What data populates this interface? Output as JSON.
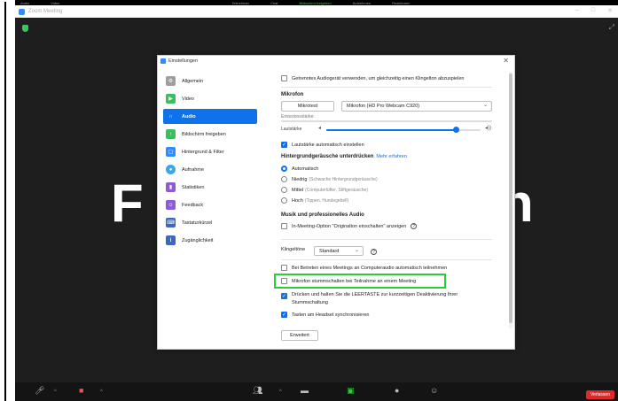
{
  "topbar": {
    "items": [
      "Audio",
      "Video",
      "Teilnehmer",
      "Chat",
      "Bildschirm freigeben",
      "Aufnehmen",
      "Reaktionen"
    ],
    "highlight_color": "#3fbf3f"
  },
  "window": {
    "title": "Zoom Meeting"
  },
  "video": {
    "left_text": "F",
    "right_text": "n"
  },
  "dialog": {
    "title": "Einstellungen",
    "sidebar": [
      {
        "label": "Allgemein",
        "icon": "gear-icon",
        "color": "#9e9e9e"
      },
      {
        "label": "Video",
        "icon": "video-icon",
        "color": "#3bbf5c"
      },
      {
        "label": "Audio",
        "icon": "headphones-icon",
        "color": "#0e72ed",
        "active": true
      },
      {
        "label": "Bildschirm freigeben",
        "icon": "share-screen-icon",
        "color": "#3bbf5c"
      },
      {
        "label": "Hintergrund & Filter",
        "icon": "background-icon",
        "color": "#2d8cff"
      },
      {
        "label": "Aufnahme",
        "icon": "record-icon",
        "color": "#3ba7e8"
      },
      {
        "label": "Statistiken",
        "icon": "statistics-icon",
        "color": "#8e5ad6"
      },
      {
        "label": "Feedback",
        "icon": "feedback-icon",
        "color": "#8e5ad6"
      },
      {
        "label": "Tastaturkürzel",
        "icon": "keyboard-icon",
        "color": "#3b66c4"
      },
      {
        "label": "Zugänglichkeit",
        "icon": "accessibility-icon",
        "color": "#3b66c4"
      }
    ],
    "audio": {
      "separate_device": "Getrenntes Audiogerät verwenden, um gleichzeitig einen Klingelton abzuspielen",
      "mic_header": "Mikrofon",
      "mic_test": "Mikrotest",
      "mic_device": "Mikrofon (HD Pro Webcam C920)",
      "emission_label": "Emissionsstärke:",
      "volume_label": "Lautstärke",
      "volume_level": 0.84,
      "auto_volume": "Lautstärke automatisch einstellen",
      "noise_header": "Hintergrundgeräusche unterdrücken",
      "learn_more": "Mehr erfahren",
      "noise_options": [
        {
          "label": "Automatisch",
          "hint": "",
          "selected": true
        },
        {
          "label": "Niedrig",
          "hint": "(Schwache Hintergrundgeräusche)",
          "selected": false
        },
        {
          "label": "Mittel",
          "hint": "(Computerlüfter, Stiftgeräusche)",
          "selected": false
        },
        {
          "label": "Hoch",
          "hint": "(Tippen, Hundegebell)",
          "selected": false
        }
      ],
      "music_header": "Musik und professionelles Audio",
      "original_sound": "In-Meeting-Option \"Originalton einschalten\" anzeigen",
      "ringtone_label": "Klingeltöne",
      "ringtone_value": "Standard",
      "auto_join_audio": "Bei Betreten eines Meetings an Computeraudio automatisch teilnehmen",
      "mute_on_join": "Mikrofon stummschalten bei Teilnahme an einem Meeting",
      "push_to_talk": "Drücken und halten Sie die LEERTASTE zur kurzzeitigen Deaktivierung Ihrer Stummschaltung",
      "sync_headset": "Tasten am Headset synchronisieren",
      "advanced": "Erweitert"
    }
  },
  "bottombar": {
    "leave": "Verlassen",
    "leave_color": "#e02828",
    "share_color": "#2ecc3a"
  },
  "highlight_color": "#2ecc3a"
}
